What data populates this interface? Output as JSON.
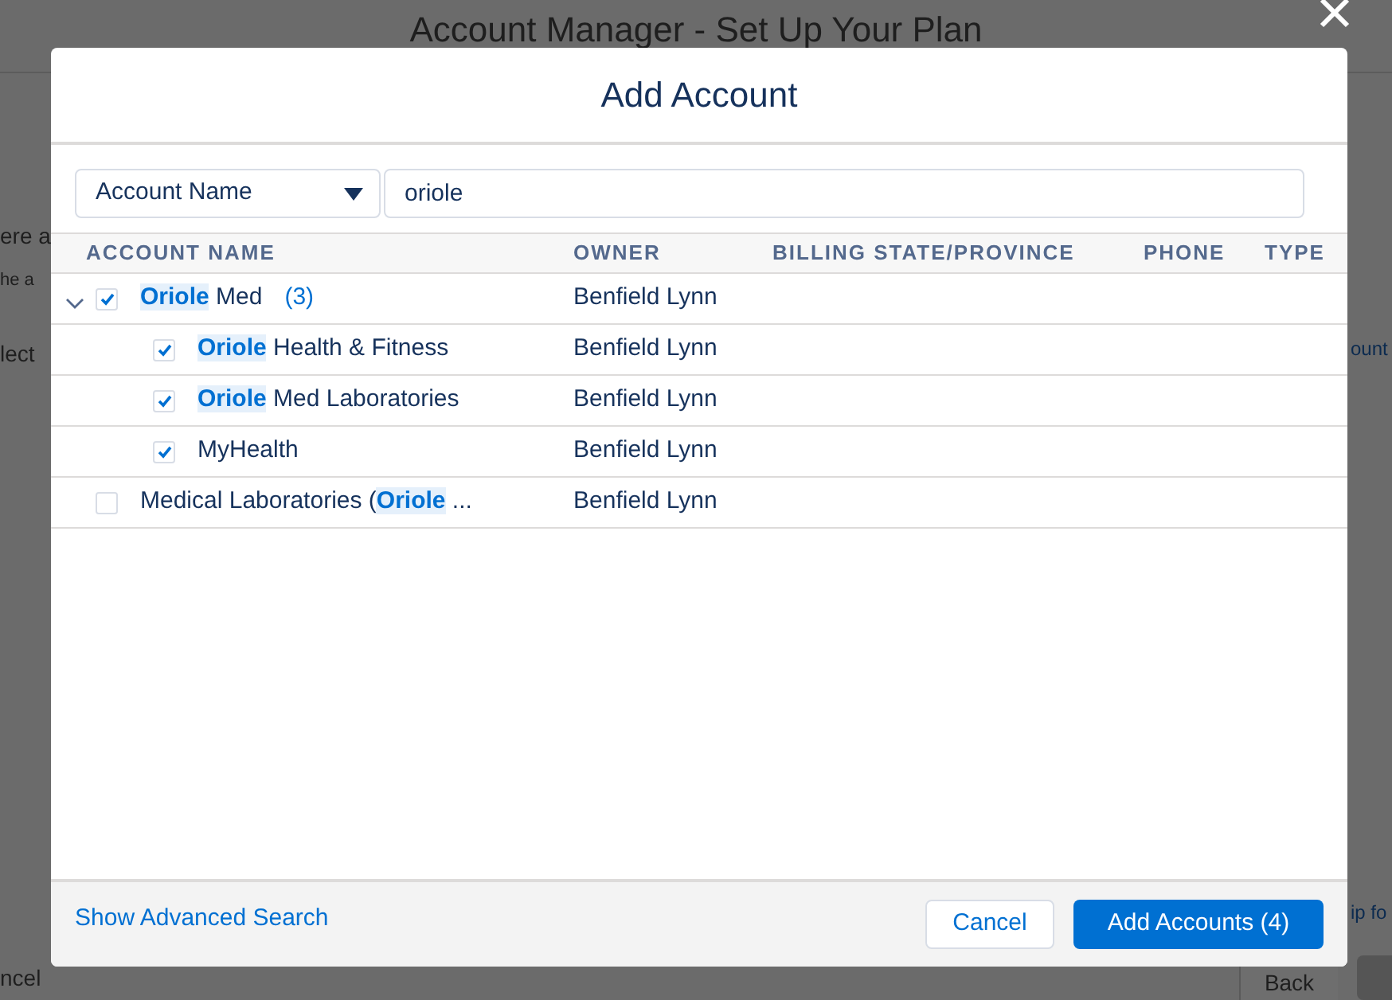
{
  "page": {
    "title": "Account Manager - Set Up Your Plan",
    "fragments_left": [
      "ere a",
      "he a",
      "lect",
      "ncel"
    ],
    "fragments_right": [
      "ount",
      "ip fo"
    ],
    "back_button": "Back"
  },
  "modal": {
    "title": "Add Account",
    "search": {
      "field_selector": "Account Name",
      "value": "oriole"
    },
    "table": {
      "columns": [
        "ACCOUNT NAME",
        "OWNER",
        "BILLING STATE/PROVINCE",
        "PHONE",
        "TYPE"
      ],
      "rows": [
        {
          "name_parts": [
            {
              "text": "Oriole",
              "match": true
            },
            {
              "text": " Med",
              "match": false
            }
          ],
          "count": "(3)",
          "owner": "Benfield Lynn",
          "checked": true,
          "expanded": true,
          "children": [
            {
              "name_parts": [
                {
                  "text": "Oriole",
                  "match": true
                },
                {
                  "text": " Health & Fitness",
                  "match": false
                }
              ],
              "owner": "Benfield Lynn",
              "checked": true
            },
            {
              "name_parts": [
                {
                  "text": "Oriole",
                  "match": true
                },
                {
                  "text": " Med Laboratories",
                  "match": false
                }
              ],
              "owner": "Benfield Lynn",
              "checked": true
            },
            {
              "name_parts": [
                {
                  "text": "MyHealth",
                  "match": false
                }
              ],
              "owner": "Benfield Lynn",
              "checked": true
            }
          ]
        },
        {
          "name_parts": [
            {
              "text": "Medical Laboratories (",
              "match": false
            },
            {
              "text": "Oriole",
              "match": true
            },
            {
              "text": " ...",
              "match": false
            }
          ],
          "owner": "Benfield Lynn",
          "checked": false
        }
      ]
    }
  },
  "footer": {
    "link": "Show Advanced Search",
    "buttons": [
      {
        "label": "Cancel",
        "kind": "neutral"
      },
      {
        "label": "Add Accounts (4)",
        "kind": "brand"
      }
    ]
  }
}
